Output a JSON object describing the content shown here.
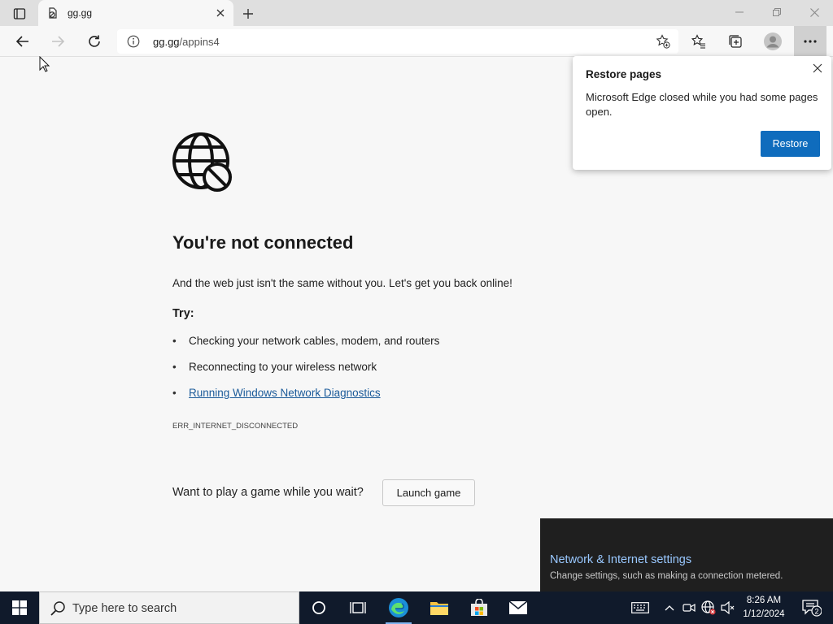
{
  "browser": {
    "tab": {
      "title": "gg.gg"
    },
    "address": {
      "host": "gg.gg",
      "path": "/appins4"
    }
  },
  "error_page": {
    "title": "You're not connected",
    "subtitle": "And the web just isn't the same without you. Let's get you back online!",
    "try_label": "Try:",
    "suggestions": [
      "Checking your network cables, modem, and routers",
      "Reconnecting to your wireless network",
      "Running Windows Network Diagnostics"
    ],
    "error_code": "ERR_INTERNET_DISCONNECTED",
    "game_prompt": "Want to play a game while you wait?",
    "game_button": "Launch game"
  },
  "restore_popup": {
    "title": "Restore pages",
    "body": "Microsoft Edge closed while you had some pages open.",
    "button": "Restore"
  },
  "network_toast": {
    "title": "Network & Internet settings",
    "subtitle": "Change settings, such as making a connection metered."
  },
  "taskbar": {
    "search_placeholder": "Type here to search",
    "time": "8:26 AM",
    "date": "1/12/2024",
    "notification_count": "2"
  },
  "colors": {
    "accent": "#0f6cbd",
    "link": "#1a5a99",
    "taskbar": "#101a2b",
    "toast": "#1f1f1f"
  }
}
